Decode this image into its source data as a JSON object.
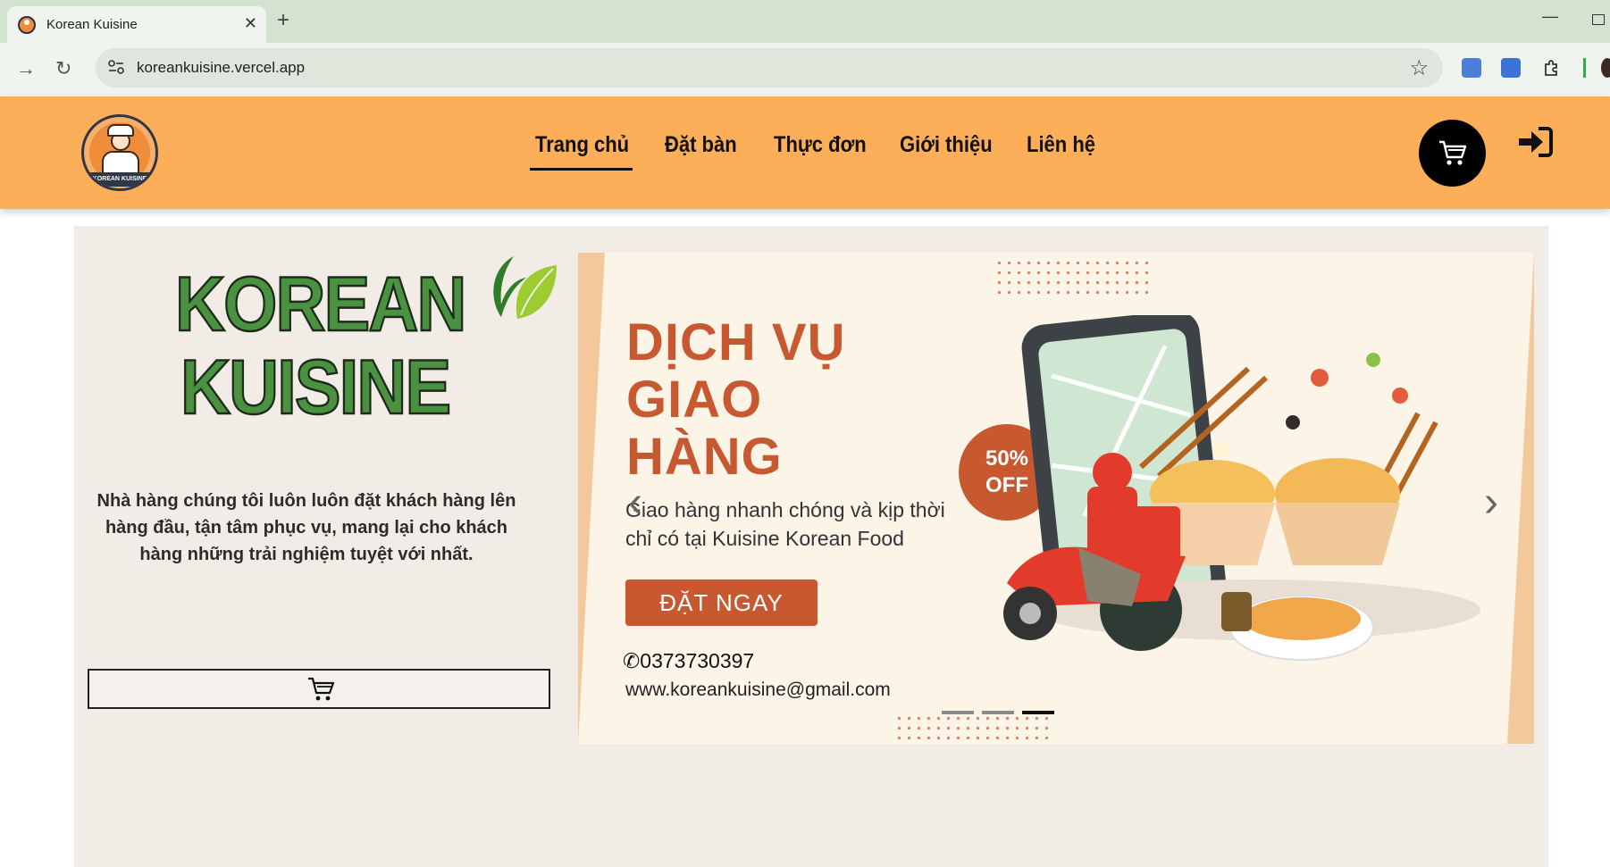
{
  "browser": {
    "tab_title": "Korean Kuisine",
    "new_tab": "+",
    "close": "✕",
    "url": "koreankuisine.vercel.app"
  },
  "header": {
    "logo_text": "KOREAN KUISINE",
    "nav": [
      {
        "label": "Trang chủ",
        "active": true
      },
      {
        "label": "Đặt bàn"
      },
      {
        "label": "Thực đơn"
      },
      {
        "label": "Giới thiệu"
      },
      {
        "label": "Liên hệ"
      }
    ]
  },
  "hero": {
    "title_line1": "KOREAN",
    "title_line2": "KUISINE",
    "description": "Nhà hàng chúng tôi luôn luôn đặt khách hàng lên hàng đầu, tận tâm phục vụ, mang lại cho khách hàng những trải nghiệm tuyệt với nhất."
  },
  "banner": {
    "heading_line1": "DỊCH VỤ",
    "heading_line2": "GIAO",
    "heading_line3": "HÀNG",
    "sub_line1": "Giao hàng nhanh chóng và kịp thời",
    "sub_line2": "chỉ có tại Kuisine Korean Food",
    "order_button": "ĐẶT NGAY",
    "phone": "0373730397",
    "email": "www.koreankuisine@gmail.com",
    "badge_percent": "50%",
    "badge_off": "OFF",
    "prev_arrow": "‹",
    "next_arrow": "›",
    "slides_total": 3,
    "active_slide": 3
  },
  "colors": {
    "header_bg": "#fcaf58",
    "title_green": "#4a9140",
    "banner_accent": "#c8582f",
    "content_bg": "#f1ece5"
  }
}
